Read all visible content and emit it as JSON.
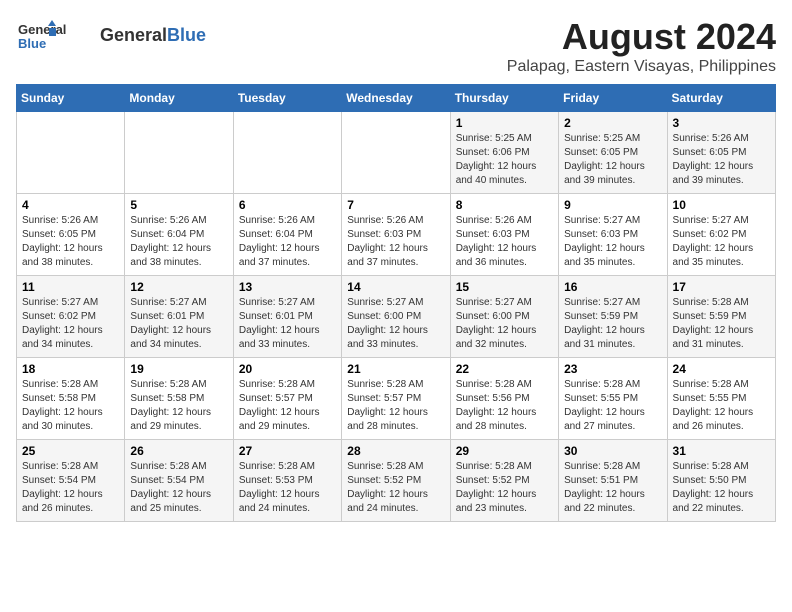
{
  "header": {
    "logo_general": "General",
    "logo_blue": "Blue",
    "main_title": "August 2024",
    "subtitle": "Palapag, Eastern Visayas, Philippines"
  },
  "weekdays": [
    "Sunday",
    "Monday",
    "Tuesday",
    "Wednesday",
    "Thursday",
    "Friday",
    "Saturday"
  ],
  "weeks": [
    [
      {
        "day": "",
        "info": ""
      },
      {
        "day": "",
        "info": ""
      },
      {
        "day": "",
        "info": ""
      },
      {
        "day": "",
        "info": ""
      },
      {
        "day": "1",
        "info": "Sunrise: 5:25 AM\nSunset: 6:06 PM\nDaylight: 12 hours\nand 40 minutes."
      },
      {
        "day": "2",
        "info": "Sunrise: 5:25 AM\nSunset: 6:05 PM\nDaylight: 12 hours\nand 39 minutes."
      },
      {
        "day": "3",
        "info": "Sunrise: 5:26 AM\nSunset: 6:05 PM\nDaylight: 12 hours\nand 39 minutes."
      }
    ],
    [
      {
        "day": "4",
        "info": "Sunrise: 5:26 AM\nSunset: 6:05 PM\nDaylight: 12 hours\nand 38 minutes."
      },
      {
        "day": "5",
        "info": "Sunrise: 5:26 AM\nSunset: 6:04 PM\nDaylight: 12 hours\nand 38 minutes."
      },
      {
        "day": "6",
        "info": "Sunrise: 5:26 AM\nSunset: 6:04 PM\nDaylight: 12 hours\nand 37 minutes."
      },
      {
        "day": "7",
        "info": "Sunrise: 5:26 AM\nSunset: 6:03 PM\nDaylight: 12 hours\nand 37 minutes."
      },
      {
        "day": "8",
        "info": "Sunrise: 5:26 AM\nSunset: 6:03 PM\nDaylight: 12 hours\nand 36 minutes."
      },
      {
        "day": "9",
        "info": "Sunrise: 5:27 AM\nSunset: 6:03 PM\nDaylight: 12 hours\nand 35 minutes."
      },
      {
        "day": "10",
        "info": "Sunrise: 5:27 AM\nSunset: 6:02 PM\nDaylight: 12 hours\nand 35 minutes."
      }
    ],
    [
      {
        "day": "11",
        "info": "Sunrise: 5:27 AM\nSunset: 6:02 PM\nDaylight: 12 hours\nand 34 minutes."
      },
      {
        "day": "12",
        "info": "Sunrise: 5:27 AM\nSunset: 6:01 PM\nDaylight: 12 hours\nand 34 minutes."
      },
      {
        "day": "13",
        "info": "Sunrise: 5:27 AM\nSunset: 6:01 PM\nDaylight: 12 hours\nand 33 minutes."
      },
      {
        "day": "14",
        "info": "Sunrise: 5:27 AM\nSunset: 6:00 PM\nDaylight: 12 hours\nand 33 minutes."
      },
      {
        "day": "15",
        "info": "Sunrise: 5:27 AM\nSunset: 6:00 PM\nDaylight: 12 hours\nand 32 minutes."
      },
      {
        "day": "16",
        "info": "Sunrise: 5:27 AM\nSunset: 5:59 PM\nDaylight: 12 hours\nand 31 minutes."
      },
      {
        "day": "17",
        "info": "Sunrise: 5:28 AM\nSunset: 5:59 PM\nDaylight: 12 hours\nand 31 minutes."
      }
    ],
    [
      {
        "day": "18",
        "info": "Sunrise: 5:28 AM\nSunset: 5:58 PM\nDaylight: 12 hours\nand 30 minutes."
      },
      {
        "day": "19",
        "info": "Sunrise: 5:28 AM\nSunset: 5:58 PM\nDaylight: 12 hours\nand 29 minutes."
      },
      {
        "day": "20",
        "info": "Sunrise: 5:28 AM\nSunset: 5:57 PM\nDaylight: 12 hours\nand 29 minutes."
      },
      {
        "day": "21",
        "info": "Sunrise: 5:28 AM\nSunset: 5:57 PM\nDaylight: 12 hours\nand 28 minutes."
      },
      {
        "day": "22",
        "info": "Sunrise: 5:28 AM\nSunset: 5:56 PM\nDaylight: 12 hours\nand 28 minutes."
      },
      {
        "day": "23",
        "info": "Sunrise: 5:28 AM\nSunset: 5:55 PM\nDaylight: 12 hours\nand 27 minutes."
      },
      {
        "day": "24",
        "info": "Sunrise: 5:28 AM\nSunset: 5:55 PM\nDaylight: 12 hours\nand 26 minutes."
      }
    ],
    [
      {
        "day": "25",
        "info": "Sunrise: 5:28 AM\nSunset: 5:54 PM\nDaylight: 12 hours\nand 26 minutes."
      },
      {
        "day": "26",
        "info": "Sunrise: 5:28 AM\nSunset: 5:54 PM\nDaylight: 12 hours\nand 25 minutes."
      },
      {
        "day": "27",
        "info": "Sunrise: 5:28 AM\nSunset: 5:53 PM\nDaylight: 12 hours\nand 24 minutes."
      },
      {
        "day": "28",
        "info": "Sunrise: 5:28 AM\nSunset: 5:52 PM\nDaylight: 12 hours\nand 24 minutes."
      },
      {
        "day": "29",
        "info": "Sunrise: 5:28 AM\nSunset: 5:52 PM\nDaylight: 12 hours\nand 23 minutes."
      },
      {
        "day": "30",
        "info": "Sunrise: 5:28 AM\nSunset: 5:51 PM\nDaylight: 12 hours\nand 22 minutes."
      },
      {
        "day": "31",
        "info": "Sunrise: 5:28 AM\nSunset: 5:50 PM\nDaylight: 12 hours\nand 22 minutes."
      }
    ]
  ]
}
